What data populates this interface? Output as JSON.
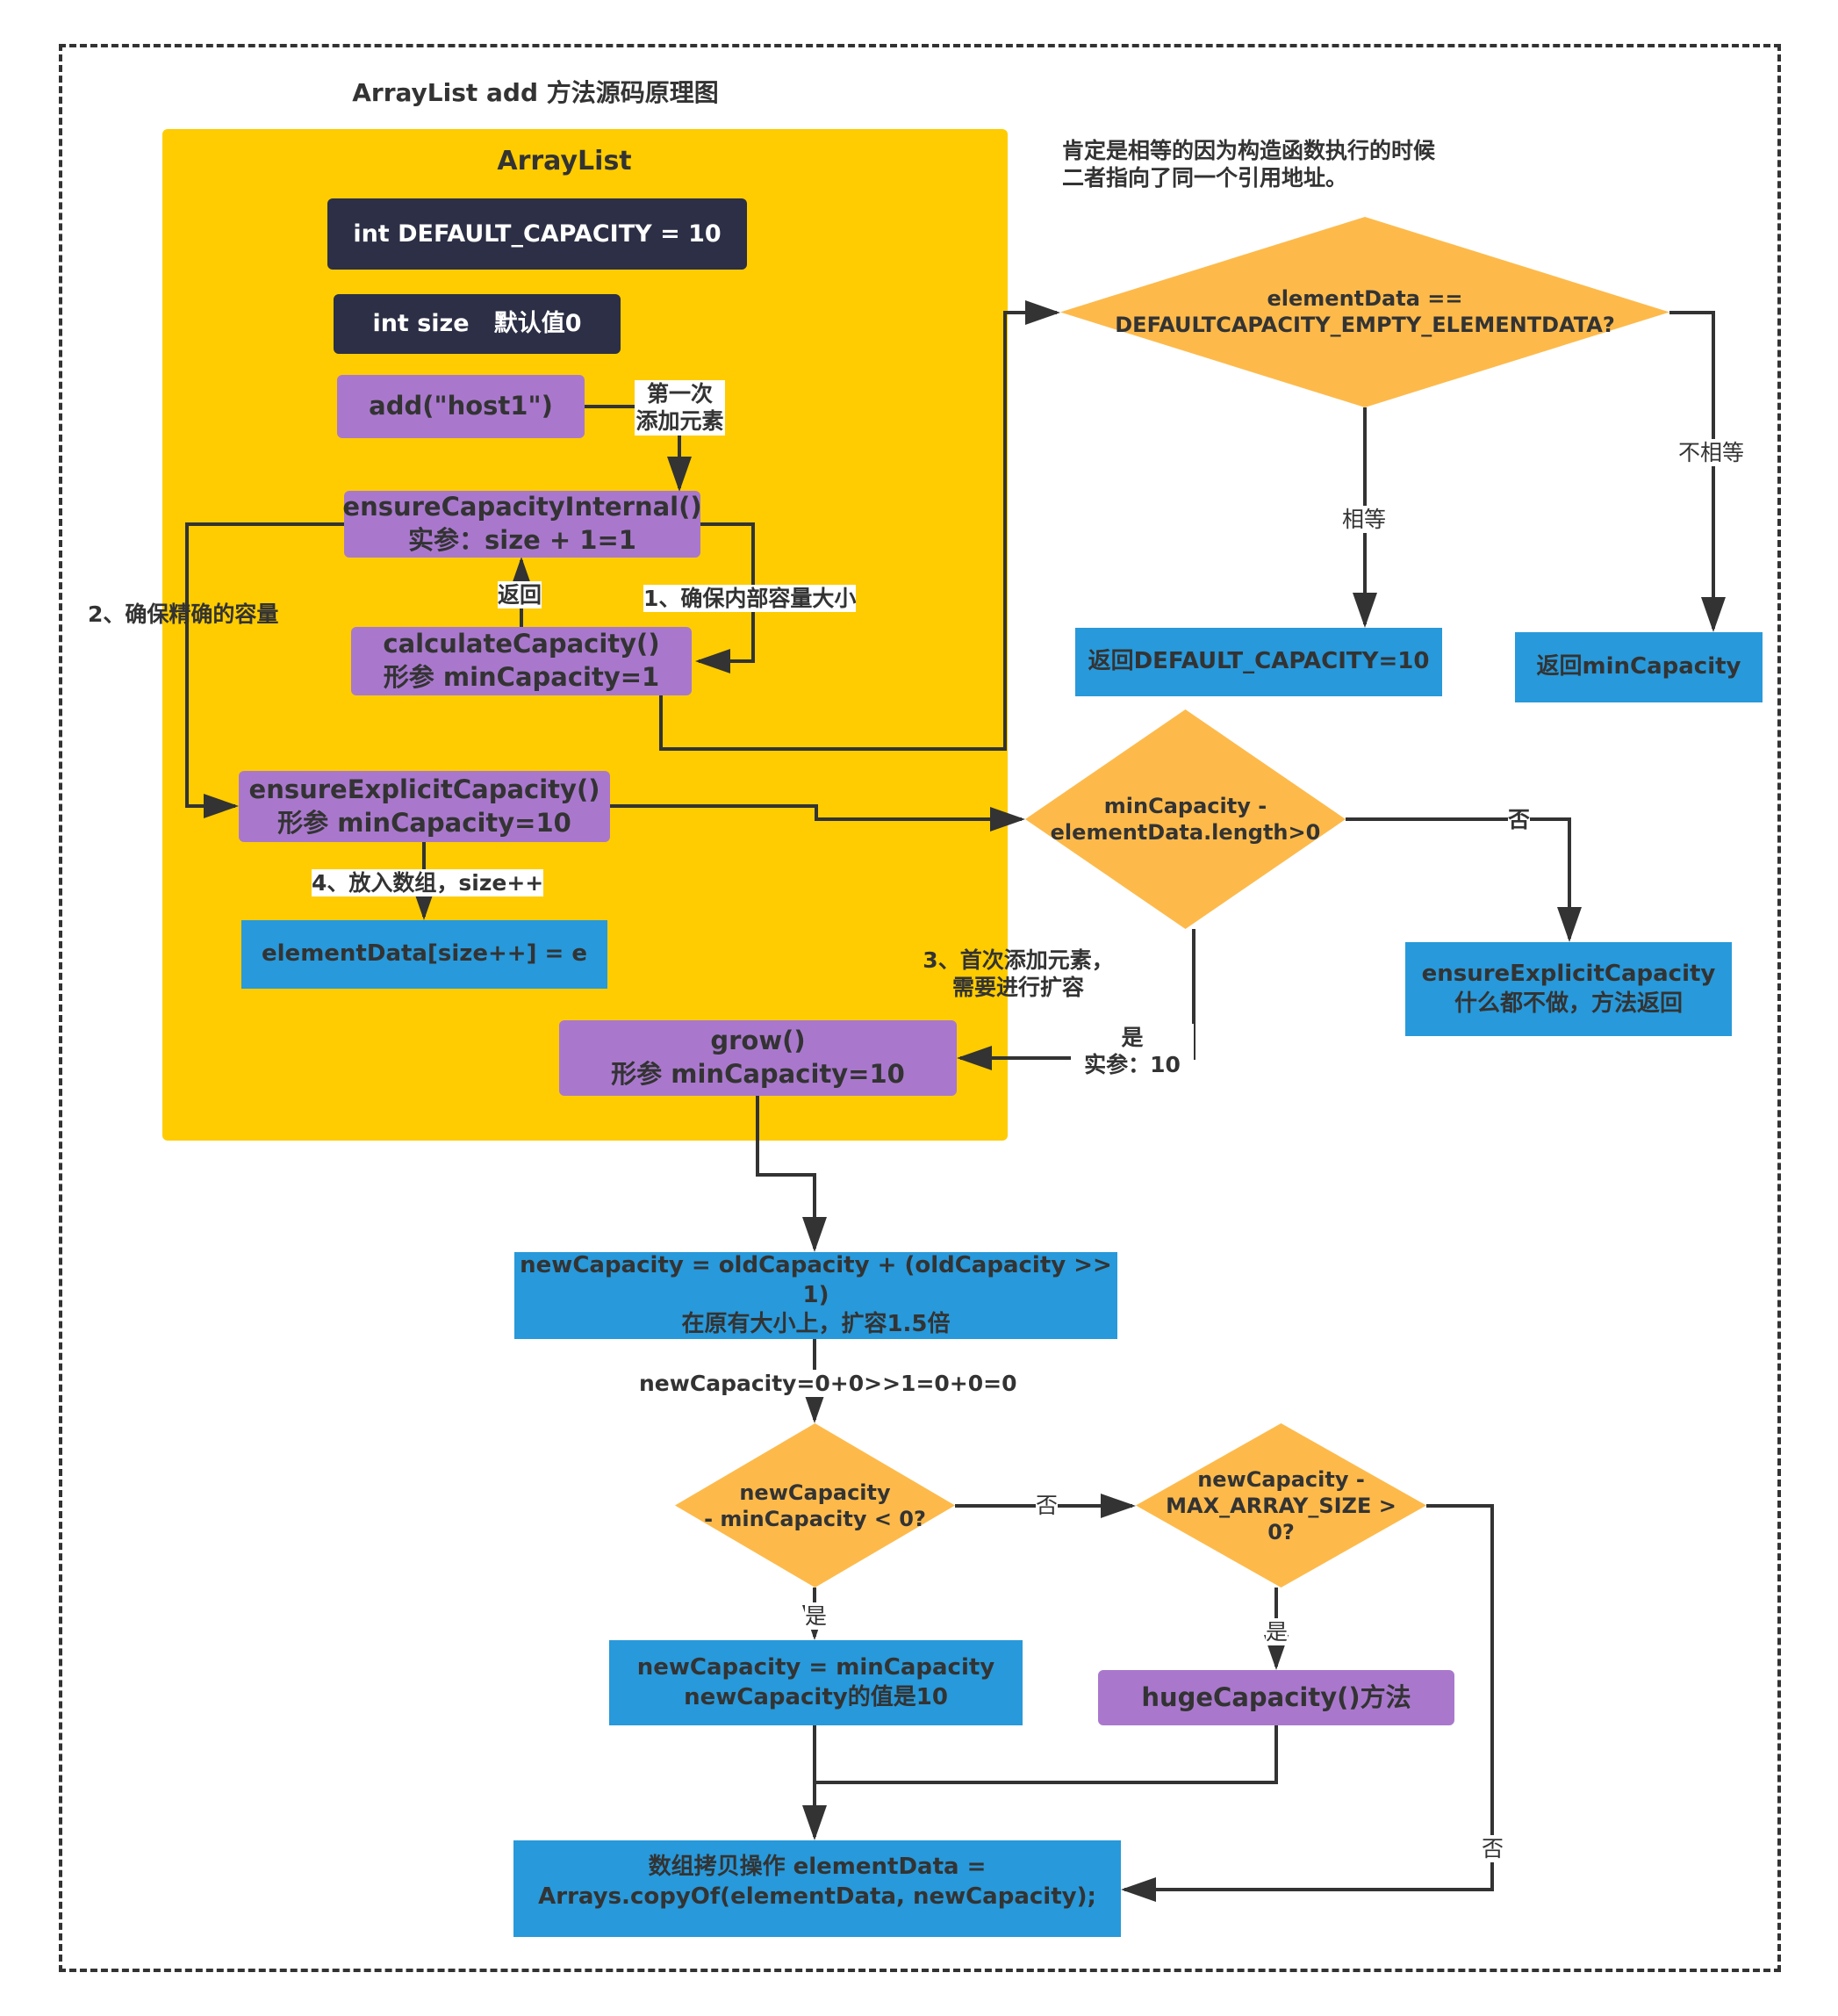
{
  "title": "ArrayList add 方法源码原理图",
  "panel": {
    "label": "ArrayList"
  },
  "colors": {
    "panel": "#FECC00",
    "field_box": "#2C2F45",
    "method_box": "#A978CC",
    "action_box": "#2899DA",
    "decision": "#FDBA4B",
    "line": "#333333"
  },
  "fields": {
    "default_capacity": "int DEFAULT_CAPACITY = 10",
    "size": "int size   默认值0"
  },
  "methods": {
    "add": "add(\"host1\")",
    "ensure_internal": [
      "ensureCapacityInternal()",
      "实参：size + 1=1"
    ],
    "calculate": [
      "calculateCapacity()",
      "形参 minCapacity=1"
    ],
    "ensure_explicit": [
      "ensureExplicitCapacity()",
      "形参 minCapacity=10"
    ],
    "grow": [
      "grow()",
      "形参 minCapacity=10"
    ],
    "huge": "hugeCapacity()方法"
  },
  "actions": {
    "element_assign": "elementData[size++] = e",
    "return_default": "返回DEFAULT_CAPACITY=10",
    "return_min": "返回minCapacity",
    "explicit_noop": [
      "ensureExplicitCapacity",
      "什么都不做，方法返回"
    ],
    "new_capacity": [
      "newCapacity = oldCapacity + (oldCapacity >> 1)",
      "在原有大小上，扩容1.5倍"
    ],
    "new_eq_min": [
      "newCapacity = minCapacity",
      "newCapacity的值是10"
    ],
    "array_copy": [
      "数组拷贝操作  elementData =",
      "Arrays.copyOf(elementData, newCapacity);"
    ]
  },
  "decisions": {
    "empty_check": [
      "elementData ==",
      "DEFAULTCAPACITY_EMPTY_ELEMENTDATA?"
    ],
    "length_check": [
      "minCapacity -",
      "elementData.length>0"
    ],
    "neg_check": [
      "newCapacity",
      "- minCapacity < 0?"
    ],
    "max_check": [
      "newCapacity -",
      "MAX_ARRAY_SIZE >",
      "0?"
    ]
  },
  "labels": {
    "first_add": [
      "第一次",
      "添加元素"
    ],
    "return": "返回",
    "step1": "1、确保内部容量大小",
    "step2": "2、确保精确的容量",
    "step3": [
      "3、首次添加元素，",
      "需要进行扩容"
    ],
    "step4": "4、放入数组，size++",
    "yes_arg": [
      "是",
      "实参：10"
    ],
    "equal": "相等",
    "not_equal": "不相等",
    "no": "否",
    "yes": "是",
    "calc": "newCapacity=0+0>>1=0+0=0"
  },
  "note": [
    "肯定是相等的因为构造函数执行的时候",
    "二者指向了同一个引用地址。"
  ]
}
